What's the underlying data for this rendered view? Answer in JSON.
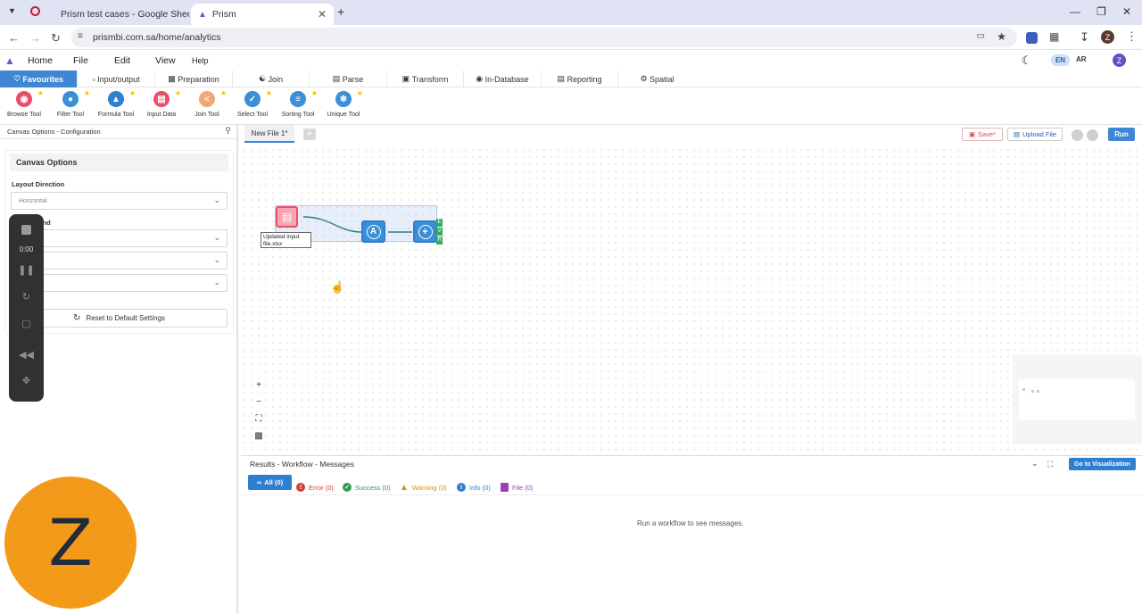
{
  "browser": {
    "tabs": [
      {
        "label": "Prism test cases - Google Sheets",
        "icon": "google-sheets-icon"
      },
      {
        "label": "Prism",
        "icon": "prism-logo-icon"
      }
    ],
    "url": "prismbi.com.sa/home/analytics",
    "profile_initial": "Z"
  },
  "menubar": {
    "items": [
      "Home",
      "File",
      "Edit",
      "View",
      "Help"
    ],
    "lang_en": "EN",
    "lang_ar": "AR",
    "user_initial": "Z"
  },
  "ribbon": {
    "tabs": [
      "Favourites",
      "Input/output",
      "Preparation",
      "Join",
      "Parse",
      "Transform",
      "In-Database",
      "Reporting",
      "Spatial"
    ],
    "active": "Favourites"
  },
  "tools": [
    {
      "label": "Browse Tool",
      "color": "#e8506a"
    },
    {
      "label": "Filter Tool",
      "color": "#3a8fd8"
    },
    {
      "label": "Formula Tool",
      "color": "#2f7fd1"
    },
    {
      "label": "Input Data",
      "color": "#e8506a"
    },
    {
      "label": "Join Tool",
      "color": "#f0a877"
    },
    {
      "label": "Select Tool",
      "color": "#3a8fd8"
    },
    {
      "label": "Sorting Tool",
      "color": "#3a8fd8"
    },
    {
      "label": "Unique Tool",
      "color": "#3a8fd8"
    }
  ],
  "left_panel": {
    "header": "Canvas Options - Configuration",
    "section_title": "Canvas Options",
    "layout_direction_label": "Layout Direction",
    "layout_direction_value": "Horizontal",
    "background_label": "Background",
    "field2_value": "r",
    "field3_value": "load",
    "field4_value": "m",
    "reset_label": "Reset to Default Settings"
  },
  "recorder": {
    "time": "0:00"
  },
  "canvas": {
    "file_tab": "New File 1*",
    "save_label": "Save*",
    "upload_label": "Upload File",
    "run_label": "Run",
    "node_caption": "Updated input file.xlsx",
    "output_anchors": [
      "E",
      "V",
      "R"
    ]
  },
  "results": {
    "title": "Results - Workflow - Messages",
    "goto_label": "Go to Visualization",
    "filters": [
      {
        "label": "All (0)",
        "color": "#2f7fd1"
      },
      {
        "label": "Error (0)",
        "color": "#d63b3b"
      },
      {
        "label": "Success (0)",
        "color": "#2e9b4d"
      },
      {
        "label": "Warning (0)",
        "color": "#e38a17"
      },
      {
        "label": "Info (0)",
        "color": "#2f7fd1"
      },
      {
        "label": "File (0)",
        "color": "#9b3fb5"
      }
    ],
    "empty_message": "Run a workflow to see messages."
  },
  "avatar_initial": "Z"
}
